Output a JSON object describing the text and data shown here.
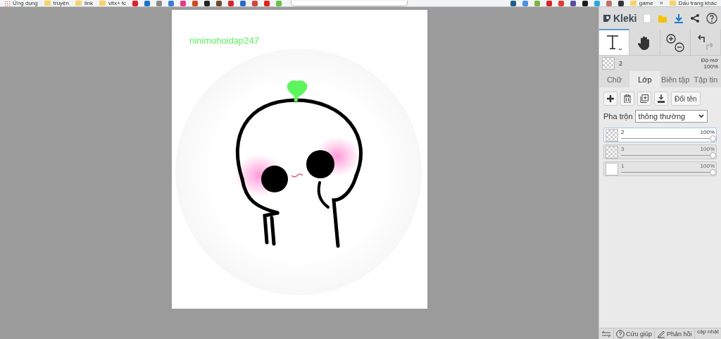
{
  "bookmarks": [
    {
      "kind": "apps",
      "label": "Ứng dụng"
    },
    {
      "kind": "folder",
      "label": "truyện"
    },
    {
      "kind": "folder",
      "label": "link"
    },
    {
      "kind": "folder",
      "label": "vitx+ tc"
    },
    {
      "kind": "site",
      "color": "#e0202a"
    },
    {
      "kind": "site",
      "color": "#1a73c8"
    },
    {
      "kind": "site",
      "color": "#888888"
    },
    {
      "kind": "site",
      "color": "#3b7bd6"
    },
    {
      "kind": "site",
      "color": "#e83a8a"
    },
    {
      "kind": "site",
      "color": "#d04a1a"
    },
    {
      "kind": "site",
      "color": "#222222"
    },
    {
      "kind": "site",
      "color": "#6b4a2a"
    },
    {
      "kind": "site",
      "color": "#d8232a"
    },
    {
      "kind": "site",
      "color": "#2a6bd0"
    },
    {
      "kind": "site",
      "color": "#d44638"
    },
    {
      "kind": "site",
      "color": "#e62117"
    },
    {
      "kind": "site",
      "color": "#6abf4b"
    }
  ],
  "bookmarks_right": [
    {
      "kind": "site",
      "color": "#1f5f8b"
    },
    {
      "kind": "site",
      "color": "#4a90e2"
    },
    {
      "kind": "site",
      "color": "#7cb342"
    },
    {
      "kind": "site",
      "color": "#e02020"
    },
    {
      "kind": "site",
      "color": "#e53935"
    },
    {
      "kind": "site",
      "color": "#5a4fa0"
    },
    {
      "kind": "site",
      "color": "#1a1a1a"
    },
    {
      "kind": "site",
      "color": "#29a8e0"
    },
    {
      "kind": "site",
      "color": "#c0706a"
    },
    {
      "kind": "site",
      "color": "#333333"
    },
    {
      "kind": "folder",
      "label": "game"
    },
    {
      "kind": "more",
      "label": "»"
    },
    {
      "kind": "folder",
      "label": "Dấu trang khác"
    }
  ],
  "canvas": {
    "watermark_text": "ninimohoidap247"
  },
  "panel": {
    "app_name": "Kleki",
    "tools": [
      {
        "kind": "text",
        "selected": true
      },
      {
        "kind": "hand",
        "selected": false
      },
      {
        "kind": "zoom",
        "selected": false
      },
      {
        "kind": "undo",
        "selected": false
      }
    ],
    "current_layer": {
      "name": "2",
      "opacity_label": "Độ mờ",
      "opacity": "100%"
    },
    "tabs": [
      {
        "label": "Chữ",
        "selected": false
      },
      {
        "label": "Lớp",
        "selected": true
      },
      {
        "label": "Biên tập",
        "selected": false
      },
      {
        "label": "Tập tin",
        "selected": false
      }
    ],
    "layer_actions": [
      {
        "kind": "add"
      },
      {
        "kind": "delete"
      },
      {
        "kind": "duplicate"
      },
      {
        "kind": "merge"
      },
      {
        "kind": "rename",
        "label": "Đổi tên"
      }
    ],
    "blend": {
      "label": "Pha trộn",
      "value": "thông thường"
    },
    "layers": [
      {
        "name": "2",
        "opacity": "100%",
        "level": 1,
        "selected": true
      },
      {
        "name": "3",
        "opacity": "100%",
        "level": 1,
        "selected": false
      },
      {
        "name": "1",
        "opacity": "100%",
        "level": 1,
        "selected": false
      }
    ],
    "footer": [
      {
        "kind": "back"
      },
      {
        "kind": "help",
        "label": "Cứu giúp"
      },
      {
        "kind": "feedback",
        "label": "Phản hồi"
      },
      {
        "kind": "update",
        "label": "cập nhật"
      }
    ]
  }
}
